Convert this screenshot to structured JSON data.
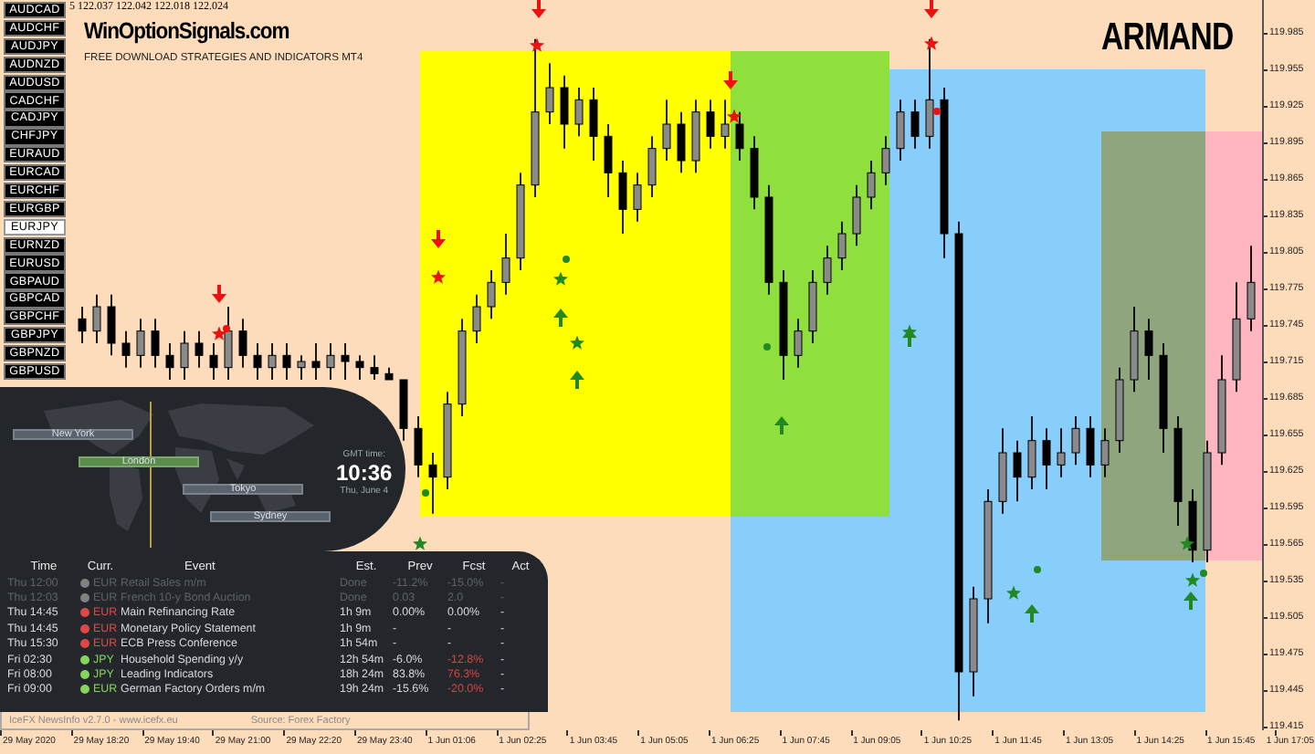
{
  "quote": "5 122.037 122.042 122.018 122.024",
  "site": {
    "title": "WinOptionSignals.com",
    "subtitle": "FREE DOWNLOAD STRATEGIES AND INDICATORS MT4"
  },
  "brand": "ARMAND",
  "symbols": [
    {
      "label": "AUDCAD",
      "selected": false
    },
    {
      "label": "AUDCHF",
      "selected": false
    },
    {
      "label": "AUDJPY",
      "selected": false
    },
    {
      "label": "AUDNZD",
      "selected": false
    },
    {
      "label": "AUDUSD",
      "selected": false
    },
    {
      "label": "CADCHF",
      "selected": false
    },
    {
      "label": "CADJPY",
      "selected": false
    },
    {
      "label": "CHFJPY",
      "selected": false
    },
    {
      "label": "EURAUD",
      "selected": false
    },
    {
      "label": "EURCAD",
      "selected": false
    },
    {
      "label": "EURCHF",
      "selected": false
    },
    {
      "label": "EURGBP",
      "selected": false
    },
    {
      "label": "EURJPY",
      "selected": true
    },
    {
      "label": "EURNZD",
      "selected": false
    },
    {
      "label": "EURUSD",
      "selected": false
    },
    {
      "label": "GBPAUD",
      "selected": false
    },
    {
      "label": "GBPCAD",
      "selected": false
    },
    {
      "label": "GBPCHF",
      "selected": false
    },
    {
      "label": "GBPJPY",
      "selected": false
    },
    {
      "label": "GBPNZD",
      "selected": false
    },
    {
      "label": "GBPUSD",
      "selected": false
    }
  ],
  "chart_data": {
    "type": "candlestick",
    "categories": [
      null,
      null,
      null,
      null,
      null,
      null,
      null,
      null,
      null,
      null,
      null,
      null,
      null,
      null,
      null,
      null,
      null,
      null,
      null,
      null,
      null,
      null,
      null,
      null,
      null,
      null,
      null,
      null,
      null,
      null,
      null,
      null,
      null,
      null,
      null,
      null,
      null,
      null,
      null,
      null,
      null,
      null,
      null,
      null,
      null,
      null,
      null,
      null,
      null,
      null,
      null,
      null,
      null,
      null,
      null,
      null,
      null,
      null,
      null,
      null,
      null,
      null,
      null,
      null,
      null,
      null,
      null,
      null,
      null,
      null,
      null,
      null,
      null,
      null,
      null,
      null,
      null,
      null,
      null,
      null,
      null
    ],
    "ylim": [
      119.412,
      120.012
    ],
    "yticks": [
      {
        "value": 119.985,
        "label": "119.985"
      },
      {
        "value": 119.955,
        "label": "119.955"
      },
      {
        "value": 119.925,
        "label": "119.925"
      },
      {
        "value": 119.895,
        "label": "119.895"
      },
      {
        "value": 119.865,
        "label": "119.865"
      },
      {
        "value": 119.835,
        "label": "119.835"
      },
      {
        "value": 119.805,
        "label": "119.805"
      },
      {
        "value": 119.775,
        "label": "119.775"
      },
      {
        "value": 119.745,
        "label": "119.745"
      },
      {
        "value": 119.715,
        "label": "119.715"
      },
      {
        "value": 119.685,
        "label": "119.685"
      },
      {
        "value": 119.655,
        "label": "119.655"
      },
      {
        "value": 119.625,
        "label": "119.625"
      },
      {
        "value": 119.595,
        "label": "119.595"
      },
      {
        "value": 119.565,
        "label": "119.565"
      },
      {
        "value": 119.535,
        "label": "119.535"
      },
      {
        "value": 119.505,
        "label": "119.505"
      },
      {
        "value": 119.475,
        "label": "119.475"
      },
      {
        "value": 119.445,
        "label": "119.445"
      },
      {
        "value": 119.415,
        "label": "119.415"
      }
    ],
    "ohlc": [
      [
        119.75,
        119.76,
        119.73,
        119.74
      ],
      [
        119.74,
        119.77,
        119.73,
        119.76
      ],
      [
        119.76,
        119.77,
        119.72,
        119.73
      ],
      [
        119.73,
        119.74,
        119.71,
        119.72
      ],
      [
        119.72,
        119.75,
        119.71,
        119.74
      ],
      [
        119.74,
        119.75,
        119.71,
        119.72
      ],
      [
        119.72,
        119.73,
        119.7,
        119.71
      ],
      [
        119.71,
        119.74,
        119.7,
        119.73
      ],
      [
        119.73,
        119.74,
        119.71,
        119.72
      ],
      [
        119.72,
        119.73,
        119.7,
        119.71
      ],
      [
        119.71,
        119.76,
        119.7,
        119.74
      ],
      [
        119.74,
        119.75,
        119.71,
        119.72
      ],
      [
        119.72,
        119.73,
        119.7,
        119.71
      ],
      [
        119.71,
        119.73,
        119.7,
        119.72
      ],
      [
        119.72,
        119.73,
        119.7,
        119.71
      ],
      [
        119.71,
        119.72,
        119.7,
        119.715
      ],
      [
        119.715,
        119.73,
        119.7,
        119.71
      ],
      [
        119.71,
        119.73,
        119.7,
        119.72
      ],
      [
        119.72,
        119.73,
        119.7,
        119.715
      ],
      [
        119.715,
        119.72,
        119.7,
        119.71
      ],
      [
        119.71,
        119.72,
        119.7,
        119.705
      ],
      [
        119.705,
        119.71,
        119.7,
        119.7
      ],
      [
        119.7,
        119.7,
        119.65,
        119.66
      ],
      [
        119.66,
        119.67,
        119.62,
        119.63
      ],
      [
        119.63,
        119.64,
        119.59,
        119.62
      ],
      [
        119.62,
        119.69,
        119.61,
        119.68
      ],
      [
        119.68,
        119.75,
        119.67,
        119.74
      ],
      [
        119.74,
        119.77,
        119.73,
        119.76
      ],
      [
        119.76,
        119.79,
        119.75,
        119.78
      ],
      [
        119.78,
        119.82,
        119.77,
        119.8
      ],
      [
        119.8,
        119.87,
        119.79,
        119.86
      ],
      [
        119.86,
        119.98,
        119.85,
        119.92
      ],
      [
        119.92,
        119.96,
        119.91,
        119.94
      ],
      [
        119.94,
        119.95,
        119.89,
        119.91
      ],
      [
        119.91,
        119.94,
        119.9,
        119.93
      ],
      [
        119.93,
        119.94,
        119.88,
        119.9
      ],
      [
        119.9,
        119.91,
        119.85,
        119.87
      ],
      [
        119.87,
        119.88,
        119.82,
        119.84
      ],
      [
        119.84,
        119.87,
        119.83,
        119.86
      ],
      [
        119.86,
        119.9,
        119.85,
        119.89
      ],
      [
        119.89,
        119.93,
        119.88,
        119.91
      ],
      [
        119.91,
        119.92,
        119.87,
        119.88
      ],
      [
        119.88,
        119.93,
        119.87,
        119.92
      ],
      [
        119.92,
        119.93,
        119.89,
        119.9
      ],
      [
        119.9,
        119.93,
        119.89,
        119.91
      ],
      [
        119.91,
        119.92,
        119.88,
        119.89
      ],
      [
        119.89,
        119.9,
        119.84,
        119.85
      ],
      [
        119.85,
        119.86,
        119.77,
        119.78
      ],
      [
        119.78,
        119.79,
        119.7,
        119.72
      ],
      [
        119.72,
        119.75,
        119.71,
        119.74
      ],
      [
        119.74,
        119.79,
        119.73,
        119.78
      ],
      [
        119.78,
        119.81,
        119.77,
        119.8
      ],
      [
        119.8,
        119.83,
        119.79,
        119.82
      ],
      [
        119.82,
        119.86,
        119.81,
        119.85
      ],
      [
        119.85,
        119.88,
        119.84,
        119.87
      ],
      [
        119.87,
        119.9,
        119.86,
        119.89
      ],
      [
        119.89,
        119.93,
        119.88,
        119.92
      ],
      [
        119.92,
        119.93,
        119.89,
        119.9
      ],
      [
        119.9,
        119.98,
        119.89,
        119.93
      ],
      [
        119.93,
        119.94,
        119.8,
        119.82
      ],
      [
        119.82,
        119.83,
        119.42,
        119.46
      ],
      [
        119.46,
        119.53,
        119.44,
        119.52
      ],
      [
        119.52,
        119.61,
        119.5,
        119.6
      ],
      [
        119.6,
        119.66,
        119.59,
        119.64
      ],
      [
        119.64,
        119.65,
        119.6,
        119.62
      ],
      [
        119.62,
        119.67,
        119.61,
        119.65
      ],
      [
        119.65,
        119.66,
        119.61,
        119.63
      ],
      [
        119.63,
        119.66,
        119.62,
        119.64
      ],
      [
        119.64,
        119.67,
        119.63,
        119.66
      ],
      [
        119.66,
        119.67,
        119.62,
        119.63
      ],
      [
        119.63,
        119.66,
        119.62,
        119.65
      ],
      [
        119.65,
        119.71,
        119.64,
        119.7
      ],
      [
        119.7,
        119.76,
        119.69,
        119.74
      ],
      [
        119.74,
        119.75,
        119.7,
        119.72
      ],
      [
        119.72,
        119.73,
        119.64,
        119.66
      ],
      [
        119.66,
        119.67,
        119.58,
        119.6
      ],
      [
        119.6,
        119.61,
        119.55,
        119.56
      ],
      [
        119.56,
        119.65,
        119.55,
        119.64
      ],
      [
        119.64,
        119.72,
        119.63,
        119.7
      ],
      [
        119.7,
        119.78,
        119.69,
        119.75
      ],
      [
        119.75,
        119.81,
        119.74,
        119.78
      ]
    ]
  },
  "zones": [
    {
      "color": "#ffff00"
    },
    {
      "color": "#87cefa"
    },
    {
      "color": "#8fe03c"
    },
    {
      "color": "#8ea57e"
    },
    {
      "color": "#ffb6c1"
    }
  ],
  "sessions": {
    "cities": [
      {
        "label": "New York",
        "active": false
      },
      {
        "label": "London",
        "active": true
      },
      {
        "label": "Tokyo",
        "active": false
      },
      {
        "label": "Sydney",
        "active": false
      }
    ],
    "gmt_label": "GMT time:",
    "time": "10:36",
    "date": "Thu, June 4"
  },
  "news": {
    "columns": [
      "Time",
      "Curr.",
      "Event",
      "Est.",
      "Prev",
      "Fcst",
      "Act"
    ],
    "rows": [
      {
        "time": "Thu 12:00",
        "currency": "EUR",
        "color": "#808080",
        "event": "Retail Sales m/m",
        "est": "Done",
        "prev": "-11.2%",
        "fcst": "-15.0%",
        "act": "-",
        "past": true,
        "fcst_negative": false
      },
      {
        "time": "Thu 12:03",
        "currency": "EUR",
        "color": "#808080",
        "event": "French 10-y Bond Auction",
        "est": "Done",
        "prev": "0.03",
        "fcst": "2.0",
        "act": "-",
        "past": true,
        "fcst_negative": false
      },
      {
        "time": "Thu 14:45",
        "currency": "EUR",
        "color": "#e04848",
        "event": "Main Refinancing Rate",
        "est": "1h 9m",
        "prev": "0.00%",
        "fcst": "0.00%",
        "act": "-",
        "past": false,
        "fcst_negative": false
      },
      {
        "time": "Thu 14:45",
        "currency": "EUR",
        "color": "#e04848",
        "event": "Monetary Policy Statement",
        "est": "1h 9m",
        "prev": "-",
        "fcst": "-",
        "act": "-",
        "past": false,
        "fcst_negative": false
      },
      {
        "time": "Thu 15:30",
        "currency": "EUR",
        "color": "#e04848",
        "event": "ECB Press Conference",
        "est": "1h 54m",
        "prev": "-",
        "fcst": "-",
        "act": "-",
        "past": false,
        "fcst_negative": false
      },
      {
        "time": "Fri 02:30",
        "currency": "JPY",
        "color": "#86d45a",
        "event": "Household Spending y/y",
        "est": "12h 54m",
        "prev": "-6.0%",
        "fcst": "-12.8%",
        "act": "-",
        "past": false,
        "fcst_negative": true
      },
      {
        "time": "Fri 08:00",
        "currency": "JPY",
        "color": "#86d45a",
        "event": "Leading Indicators",
        "est": "18h 24m",
        "prev": "83.8%",
        "fcst": "76.3%",
        "act": "-",
        "past": false,
        "fcst_negative": true
      },
      {
        "time": "Fri 09:00",
        "currency": "EUR",
        "color": "#86d45a",
        "event": "German Factory Orders m/m",
        "est": "19h 24m",
        "prev": "-15.6%",
        "fcst": "-20.0%",
        "act": "-",
        "past": false,
        "fcst_negative": true
      }
    ],
    "footer": "IceFX NewsInfo v2.7.0  -  www.icefx.eu",
    "source": "Source: Forex Factory"
  },
  "time_axis": [
    "29 May 2020",
    "29 May 18:20",
    "29 May 19:40",
    "29 May 21:00",
    "29 May 22:20",
    "29 May 23:40",
    "1 Jun 01:06",
    "1 Jun 02:25",
    "1 Jun 03:45",
    "1 Jun 05:05",
    "1 Jun 06:25",
    "1 Jun 07:45",
    "1 Jun 09:05",
    "1 Jun 10:25",
    "1 Jun 11:45",
    "1 Jun 13:05",
    "1 Jun 14:25",
    "1 Jun 15:45",
    "1 Jun 17:05"
  ]
}
